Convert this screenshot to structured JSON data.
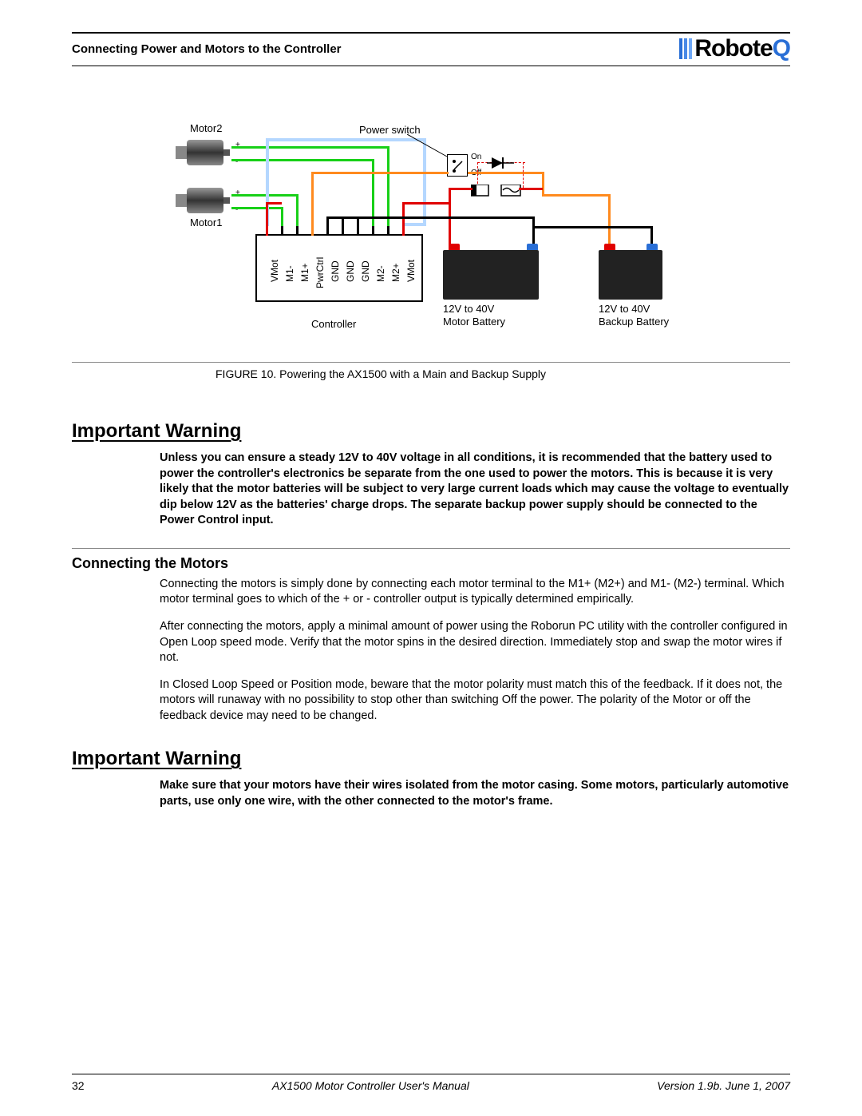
{
  "header": {
    "title": "Connecting Power and Motors to the Controller",
    "logo": "RoboteQ"
  },
  "diagram": {
    "motor2": "Motor2",
    "motor1": "Motor1",
    "plus": "+",
    "minus": "-",
    "power_switch": "Power switch",
    "on": "On",
    "off": "Off",
    "controller": "Controller",
    "pins": [
      "VMot",
      "M1-",
      "M1+",
      "PwrCtrl",
      "GND",
      "GND",
      "GND",
      "M2-",
      "M2+",
      "VMot"
    ],
    "batt_v1": "12V to 40V",
    "batt_l1": "Motor Battery",
    "batt_v2": "12V to 40V",
    "batt_l2": "Backup Battery"
  },
  "caption": "FIGURE 10.  Powering the AX1500 with a Main and Backup Supply",
  "warning1_heading": "Important Warning",
  "warning1_body": "Unless you can ensure a steady 12V to 40V voltage in all conditions, it is recommended that the battery used to power the controller's electronics be separate from the one used to power the motors. This is because it is very likely that the motor batteries will be subject to very large current loads which may cause the voltage to eventually dip below 12V as the batteries' charge drops. The separate backup power supply should be connected to the Power Control input.",
  "section_heading": "Connecting the Motors",
  "body_p1": "Connecting the motors is simply done by connecting each motor terminal to the M1+ (M2+) and M1- (M2-) terminal. Which motor terminal goes to which of the + or - controller output is typically determined empirically.",
  "body_p2": "After connecting the motors, apply a minimal amount of power using the Roborun PC utility with the controller configured in Open Loop speed mode. Verify that the motor spins in the desired direction. Immediately stop and swap the motor wires if not.",
  "body_p3": "In Closed Loop Speed or Position mode, beware that the motor polarity must match this of the feedback. If it does not, the motors will runaway with no possibility to stop other than switching Off the power. The polarity of the Motor or off the feedback device may need to be changed.",
  "warning2_heading": "Important Warning",
  "warning2_body": "Make sure that your motors have their wires isolated from the motor casing. Some motors, particularly automotive parts, use only one wire, with the other connected to the motor's frame.",
  "footer": {
    "page": "32",
    "center": "AX1500 Motor Controller User's Manual",
    "right": "Version 1.9b. June 1, 2007"
  }
}
